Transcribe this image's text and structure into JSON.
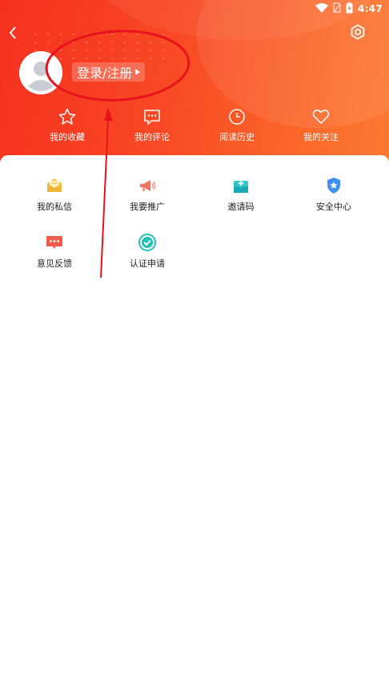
{
  "status_bar": {
    "time": "4:47"
  },
  "header": {
    "login_label": "登录/注册",
    "quick_links": [
      {
        "label": "我的收藏",
        "icon": "star-icon"
      },
      {
        "label": "我的评论",
        "icon": "comment-icon"
      },
      {
        "label": "阅读历史",
        "icon": "clock-icon"
      },
      {
        "label": "我的关注",
        "icon": "heart-icon"
      }
    ]
  },
  "menu": {
    "items": [
      {
        "label": "我的私信",
        "icon": "mail-icon",
        "color": "#f0b63a"
      },
      {
        "label": "我要推广",
        "icon": "megaphone-icon",
        "color": "#f0735f"
      },
      {
        "label": "邀请码",
        "icon": "invite-icon",
        "color": "#2fc7c9"
      },
      {
        "label": "安全中心",
        "icon": "shield-icon",
        "color": "#3f8ff0"
      },
      {
        "label": "意见反馈",
        "icon": "feedback-icon",
        "color": "#f05c4c"
      },
      {
        "label": "认证申请",
        "icon": "verify-icon",
        "color": "#22c1b7"
      }
    ]
  },
  "colors": {
    "header_start": "#f5301f",
    "header_end": "#fd7a32",
    "annotation": "#e8121c"
  }
}
